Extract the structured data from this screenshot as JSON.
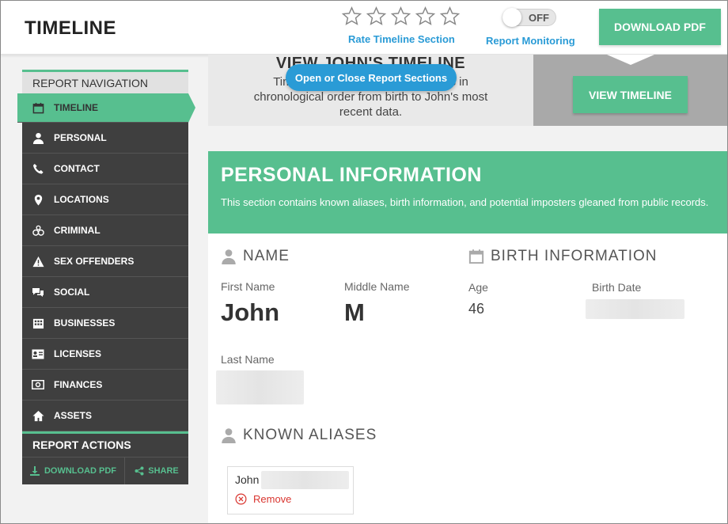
{
  "header": {
    "title": "TIMELINE",
    "rate_label": "Rate Timeline Section",
    "stars_total": 5,
    "stars_filled": 0,
    "toggle_state": "OFF",
    "monitor_label": "Report Monitoring",
    "download_label": "DOWNLOAD PDF"
  },
  "sidebar": {
    "nav_title": "REPORT NAVIGATION",
    "items": [
      {
        "label": "TIMELINE",
        "icon": "calendar-icon"
      },
      {
        "label": "PERSONAL",
        "icon": "person-icon"
      },
      {
        "label": "CONTACT",
        "icon": "phone-icon"
      },
      {
        "label": "LOCATIONS",
        "icon": "map-pin-icon"
      },
      {
        "label": "CRIMINAL",
        "icon": "handcuffs-icon"
      },
      {
        "label": "SEX OFFENDERS",
        "icon": "warning-icon"
      },
      {
        "label": "SOCIAL",
        "icon": "chat-icon"
      },
      {
        "label": "BUSINESSES",
        "icon": "building-icon"
      },
      {
        "label": "LICENSES",
        "icon": "id-card-icon"
      },
      {
        "label": "FINANCES",
        "icon": "money-icon"
      },
      {
        "label": "ASSETS",
        "icon": "house-icon"
      }
    ],
    "actions_title": "REPORT ACTIONS",
    "download_label": "DOWNLOAD PDF",
    "share_label": "SHARE"
  },
  "timeline_banner": {
    "title": "VIEW JOHN'S TIMELINE",
    "desc": "Timeline of John's report highlights in chronological order from birth to John's most recent data.",
    "view_button": "VIEW TIMELINE",
    "sections_pill": "Open or Close Report Sections"
  },
  "personal": {
    "title": "PERSONAL INFORMATION",
    "desc": "This section contains known aliases, birth information, and potential imposters gleaned from public records.",
    "name_group": "NAME",
    "first_name_label": "First Name",
    "first_name": "John",
    "middle_name_label": "Middle Name",
    "middle_name": "M",
    "last_name_label": "Last Name",
    "birth_group": "BIRTH INFORMATION",
    "age_label": "Age",
    "age": "46",
    "birth_date_label": "Birth Date",
    "aliases_group": "KNOWN ALIASES",
    "alias_name": "John",
    "remove_label": "Remove"
  },
  "colors": {
    "accent": "#57bf8f",
    "link": "#2a9bd6",
    "sidebar": "#3f3f3f",
    "remove": "#d9352f"
  }
}
